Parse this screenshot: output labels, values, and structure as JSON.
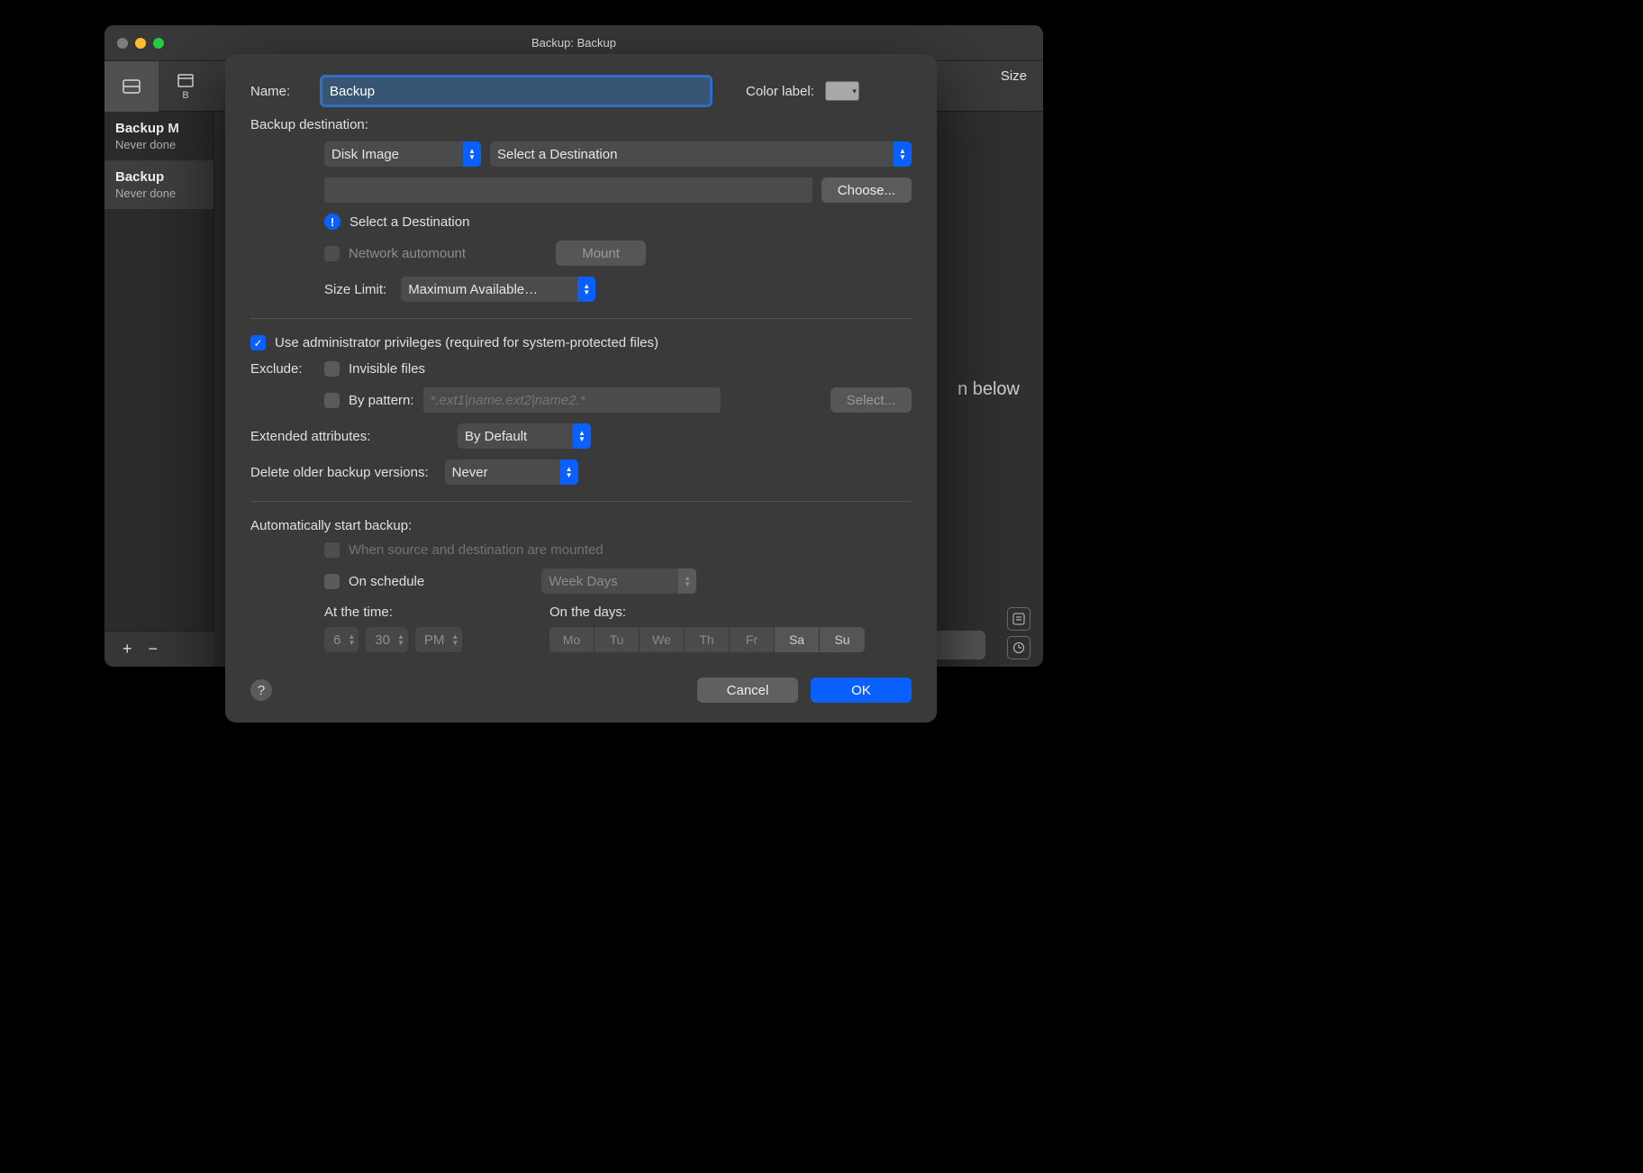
{
  "window": {
    "title": "Backup: Backup",
    "toolbar_right": "Size",
    "tab_b_caption": "B"
  },
  "sidebar": {
    "items": [
      {
        "title": "Backup M",
        "subtitle": "Never done"
      },
      {
        "title": "Backup",
        "subtitle": "Never done"
      }
    ]
  },
  "main_hint": "n below",
  "footer": {
    "plus": "+",
    "minus": "−"
  },
  "sheet": {
    "name_label": "Name:",
    "name_value": "Backup",
    "color_label": "Color label:",
    "dest_heading": "Backup destination:",
    "dest_type": "Disk Image",
    "dest_select": "Select a Destination",
    "choose_btn": "Choose...",
    "dest_warning": "Select a Destination",
    "net_automount": "Network automount",
    "mount_btn": "Mount",
    "size_limit_label": "Size Limit:",
    "size_limit_value": "Maximum Available…",
    "admin_priv": "Use administrator privileges (required for system-protected files)",
    "exclude_label": "Exclude:",
    "invisible_files": "Invisible files",
    "by_pattern": "By pattern:",
    "pattern_placeholder": "*.ext1|name.ext2|name2.*",
    "select_btn": "Select...",
    "ext_attr_label": "Extended attributes:",
    "ext_attr_value": "By Default",
    "delete_older_label": "Delete older backup versions:",
    "delete_older_value": "Never",
    "auto_heading": "Automatically start backup:",
    "when_mounted": "When source and destination are mounted",
    "on_schedule": "On schedule",
    "schedule_mode": "Week Days",
    "at_time_label": "At the time:",
    "time_hour": "6",
    "time_min": "30",
    "time_ampm": "PM",
    "on_days_label": "On the days:",
    "days": [
      "Mo",
      "Tu",
      "We",
      "Th",
      "Fr",
      "Sa",
      "Su"
    ],
    "cancel": "Cancel",
    "ok": "OK",
    "help": "?"
  }
}
